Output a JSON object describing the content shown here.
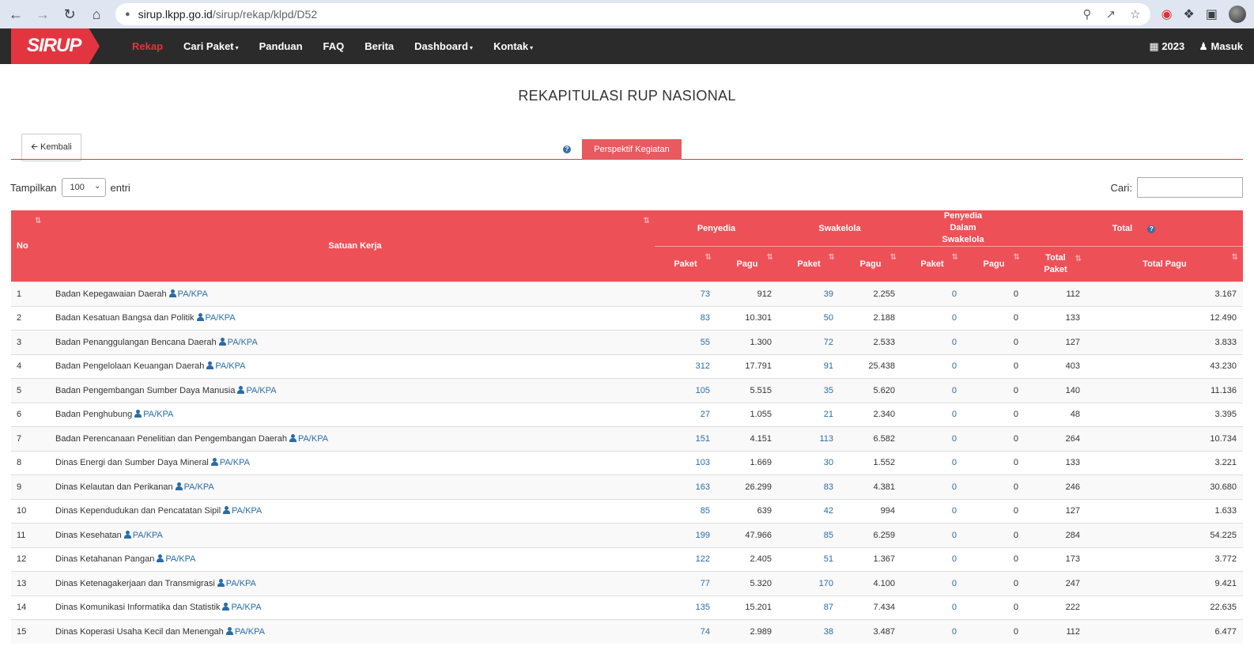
{
  "browser": {
    "url_host": "sirup.lkpp.go.id",
    "url_path": "/sirup/rekap/klpd/D52"
  },
  "navbar": {
    "logo": "SIRUP",
    "items": [
      {
        "label": "Rekap",
        "active": true,
        "dropdown": false
      },
      {
        "label": "Cari Paket",
        "dropdown": true
      },
      {
        "label": "Panduan",
        "dropdown": false
      },
      {
        "label": "FAQ",
        "dropdown": false
      },
      {
        "label": "Berita",
        "dropdown": false
      },
      {
        "label": "Dashboard",
        "dropdown": true
      },
      {
        "label": "Kontak",
        "dropdown": true
      }
    ],
    "year": "2023",
    "login": "Masuk"
  },
  "page": {
    "title": "REKAPITULASI RUP NASIONAL",
    "back_label": "Kembali",
    "tab_label": "Perspektif Kegiatan",
    "show_label": "Tampilkan",
    "show_value": "100",
    "entries_label": "entri",
    "search_label": "Cari:"
  },
  "table": {
    "headers": {
      "no": "No",
      "satker": "Satuan Kerja",
      "penyedia": "Penyedia",
      "swakelola": "Swakelola",
      "pds": "Penyedia Dalam Swakelola",
      "total": "Total",
      "paket": "Paket",
      "pagu": "Pagu",
      "total_paket": "Total Paket",
      "total_pagu": "Total Pagu"
    },
    "pa_label": "PA/KPA",
    "rows": [
      {
        "no": "1",
        "name": "Badan Kepegawaian Daerah",
        "p_paket": "73",
        "p_pagu": "912",
        "s_paket": "39",
        "s_pagu": "2.255",
        "d_paket": "0",
        "d_pagu": "0",
        "t_paket": "112",
        "t_pagu": "3.167"
      },
      {
        "no": "2",
        "name": "Badan Kesatuan Bangsa dan Politik",
        "p_paket": "83",
        "p_pagu": "10.301",
        "s_paket": "50",
        "s_pagu": "2.188",
        "d_paket": "0",
        "d_pagu": "0",
        "t_paket": "133",
        "t_pagu": "12.490"
      },
      {
        "no": "3",
        "name": "Badan Penanggulangan Bencana Daerah",
        "p_paket": "55",
        "p_pagu": "1.300",
        "s_paket": "72",
        "s_pagu": "2.533",
        "d_paket": "0",
        "d_pagu": "0",
        "t_paket": "127",
        "t_pagu": "3.833"
      },
      {
        "no": "4",
        "name": "Badan Pengelolaan Keuangan Daerah",
        "p_paket": "312",
        "p_pagu": "17.791",
        "s_paket": "91",
        "s_pagu": "25.438",
        "d_paket": "0",
        "d_pagu": "0",
        "t_paket": "403",
        "t_pagu": "43.230"
      },
      {
        "no": "5",
        "name": "Badan Pengembangan Sumber Daya Manusia",
        "p_paket": "105",
        "p_pagu": "5.515",
        "s_paket": "35",
        "s_pagu": "5.620",
        "d_paket": "0",
        "d_pagu": "0",
        "t_paket": "140",
        "t_pagu": "11.136"
      },
      {
        "no": "6",
        "name": "Badan Penghubung",
        "p_paket": "27",
        "p_pagu": "1.055",
        "s_paket": "21",
        "s_pagu": "2.340",
        "d_paket": "0",
        "d_pagu": "0",
        "t_paket": "48",
        "t_pagu": "3.395"
      },
      {
        "no": "7",
        "name": "Badan Perencanaan Penelitian dan Pengembangan Daerah",
        "p_paket": "151",
        "p_pagu": "4.151",
        "s_paket": "113",
        "s_pagu": "6.582",
        "d_paket": "0",
        "d_pagu": "0",
        "t_paket": "264",
        "t_pagu": "10.734"
      },
      {
        "no": "8",
        "name": "Dinas Energi dan Sumber Daya Mineral",
        "p_paket": "103",
        "p_pagu": "1.669",
        "s_paket": "30",
        "s_pagu": "1.552",
        "d_paket": "0",
        "d_pagu": "0",
        "t_paket": "133",
        "t_pagu": "3.221"
      },
      {
        "no": "9",
        "name": "Dinas Kelautan dan Perikanan",
        "p_paket": "163",
        "p_pagu": "26.299",
        "s_paket": "83",
        "s_pagu": "4.381",
        "d_paket": "0",
        "d_pagu": "0",
        "t_paket": "246",
        "t_pagu": "30.680"
      },
      {
        "no": "10",
        "name": "Dinas Kependudukan dan Pencatatan Sipil",
        "p_paket": "85",
        "p_pagu": "639",
        "s_paket": "42",
        "s_pagu": "994",
        "d_paket": "0",
        "d_pagu": "0",
        "t_paket": "127",
        "t_pagu": "1.633"
      },
      {
        "no": "11",
        "name": "Dinas Kesehatan",
        "p_paket": "199",
        "p_pagu": "47.966",
        "s_paket": "85",
        "s_pagu": "6.259",
        "d_paket": "0",
        "d_pagu": "0",
        "t_paket": "284",
        "t_pagu": "54.225"
      },
      {
        "no": "12",
        "name": "Dinas Ketahanan Pangan",
        "p_paket": "122",
        "p_pagu": "2.405",
        "s_paket": "51",
        "s_pagu": "1.367",
        "d_paket": "0",
        "d_pagu": "0",
        "t_paket": "173",
        "t_pagu": "3.772"
      },
      {
        "no": "13",
        "name": "Dinas Ketenagakerjaan dan Transmigrasi",
        "p_paket": "77",
        "p_pagu": "5.320",
        "s_paket": "170",
        "s_pagu": "4.100",
        "d_paket": "0",
        "d_pagu": "0",
        "t_paket": "247",
        "t_pagu": "9.421"
      },
      {
        "no": "14",
        "name": "Dinas Komunikasi Informatika dan Statistik",
        "p_paket": "135",
        "p_pagu": "15.201",
        "s_paket": "87",
        "s_pagu": "7.434",
        "d_paket": "0",
        "d_pagu": "0",
        "t_paket": "222",
        "t_pagu": "22.635"
      },
      {
        "no": "15",
        "name": "Dinas Koperasi Usaha Kecil dan Menengah",
        "p_paket": "74",
        "p_pagu": "2.989",
        "s_paket": "38",
        "s_pagu": "3.487",
        "d_paket": "0",
        "d_pagu": "0",
        "t_paket": "112",
        "t_pagu": "6.477"
      }
    ]
  },
  "colors": {
    "brand_red": "#e3353f",
    "header_red": "#ee5058",
    "link_blue": "#2a6ca8",
    "navbar_dark": "#2b2b2b"
  }
}
